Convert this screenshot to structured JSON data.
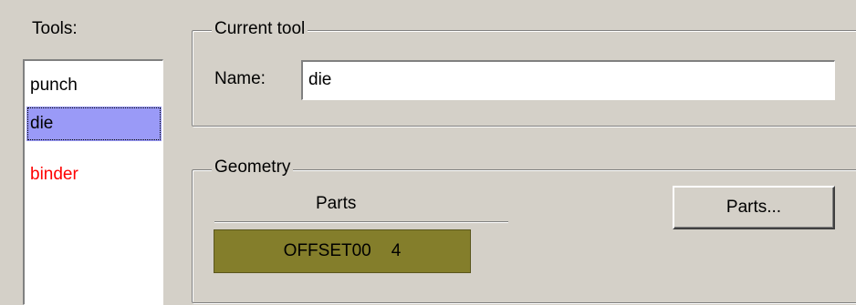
{
  "tools_panel": {
    "label": "Tools:",
    "items": [
      {
        "label": "punch",
        "selected": false,
        "color": "#000000"
      },
      {
        "label": "die",
        "selected": true,
        "color": "#000000"
      },
      {
        "label": "binder",
        "selected": false,
        "color": "#ff0000"
      }
    ]
  },
  "current_tool": {
    "title": "Current tool",
    "name_label": "Name:",
    "name_value": "die"
  },
  "geometry": {
    "title": "Geometry",
    "parts_header": "Parts",
    "parts": [
      {
        "name": "OFFSET00",
        "count": "4"
      }
    ],
    "parts_button_label": "Parts..."
  },
  "colors": {
    "selection": "#9a9af7",
    "part_row": "#847e2b",
    "binder_text": "#ff0000"
  }
}
